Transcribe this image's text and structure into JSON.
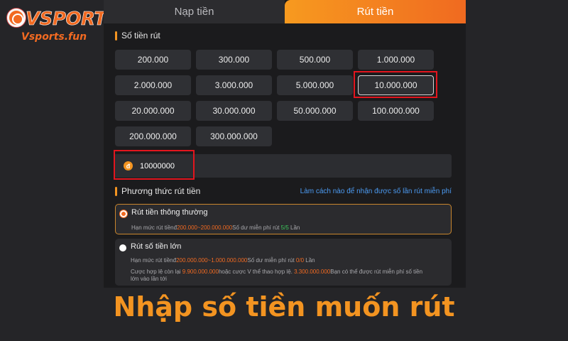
{
  "logo": {
    "word": "VSPORT",
    "site": "Vsports.fun"
  },
  "tabs": [
    {
      "label": "Nạp tiền",
      "active": false
    },
    {
      "label": "Rút tiền",
      "active": true
    }
  ],
  "amount_section": {
    "title": "Số tiền rút",
    "options": [
      "200.000",
      "300.000",
      "500.000",
      "1.000.000",
      "2.000.000",
      "3.000.000",
      "5.000.000",
      "10.000.000",
      "20.000.000",
      "30.000.000",
      "50.000.000",
      "100.000.000",
      "200.000.000",
      "300.000.000"
    ],
    "selected": "10.000.000",
    "currency_icon": "đ",
    "input_value": "10000000"
  },
  "method_section": {
    "title": "Phương thức rút tiền",
    "help_link": "Làm cách nào để nhận được số lần rút miễn phí",
    "methods": [
      {
        "title": "Rút tiền thông thường",
        "selected": true,
        "limit_label": "Hạn mức rút tiền",
        "currency": "đ",
        "range": "200.000~200.000.000",
        "free_label": "Số dư miễn phí rút",
        "free_count": "5/5",
        "unit": "Lần"
      },
      {
        "title": "Rút số tiền lớn",
        "selected": false,
        "limit_label": "Hạn mức rút tiền",
        "currency": "đ",
        "range": "200.000.000~1.000.000.000",
        "free_label": "Số dư miễn phí rút",
        "free_count": "0/0",
        "unit": "Lần",
        "note_prefix": "Cược hợp lệ còn lại",
        "remaining_bet": "9.900.000.000",
        "note_mid": "hoặc cược V thể thao hợp lệ.",
        "sport_bet": "3.300.000.000",
        "note_suffix_1": "Bạn có thể được rút miễn phí số tiền",
        "note_suffix_2": "lớn vào lần tới"
      }
    ]
  },
  "caption": "Nhập số tiền muốn rút",
  "colors": {
    "accent": "#f39421",
    "highlight": "#e3151e",
    "link": "#4c9bf2",
    "success": "#3cc35a"
  }
}
